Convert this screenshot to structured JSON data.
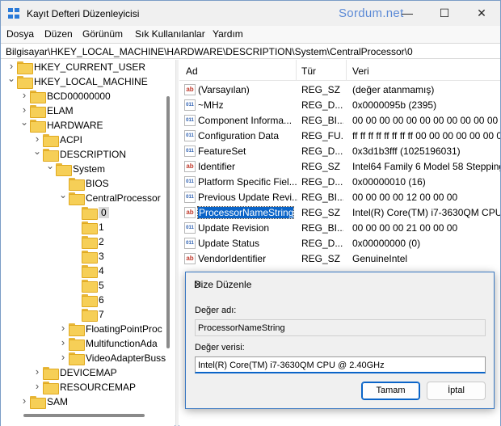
{
  "window": {
    "title": "Kayıt Defteri Düzenleyicisi",
    "watermark": "Sordum.net",
    "minimize": "—",
    "maximize": "☐",
    "close": "✕"
  },
  "menu": [
    "Dosya",
    "Düzen",
    "Görünüm",
    "Sık Kullanılanlar",
    "Yardım"
  ],
  "address": "Bilgisayar\\HKEY_LOCAL_MACHINE\\HARDWARE\\DESCRIPTION\\System\\CentralProcessor\\0",
  "tree": [
    {
      "label": "HKEY_CURRENT_USER",
      "level": 0,
      "chev": ">"
    },
    {
      "label": "HKEY_LOCAL_MACHINE",
      "level": 0,
      "chev": "v"
    },
    {
      "label": "BCD00000000",
      "level": 1,
      "chev": ">"
    },
    {
      "label": "ELAM",
      "level": 1,
      "chev": ">"
    },
    {
      "label": "HARDWARE",
      "level": 1,
      "chev": "v"
    },
    {
      "label": "ACPI",
      "level": 2,
      "chev": ">"
    },
    {
      "label": "DESCRIPTION",
      "level": 2,
      "chev": "v"
    },
    {
      "label": "System",
      "level": 3,
      "chev": "v"
    },
    {
      "label": "BIOS",
      "level": 4,
      "chev": ""
    },
    {
      "label": "CentralProcessor",
      "level": 4,
      "chev": "v"
    },
    {
      "label": "0",
      "level": 5,
      "chev": "",
      "selected": true
    },
    {
      "label": "1",
      "level": 5,
      "chev": ""
    },
    {
      "label": "2",
      "level": 5,
      "chev": ""
    },
    {
      "label": "3",
      "level": 5,
      "chev": ""
    },
    {
      "label": "4",
      "level": 5,
      "chev": ""
    },
    {
      "label": "5",
      "level": 5,
      "chev": ""
    },
    {
      "label": "6",
      "level": 5,
      "chev": ""
    },
    {
      "label": "7",
      "level": 5,
      "chev": ""
    },
    {
      "label": "FloatingPointProc",
      "level": 4,
      "chev": ">"
    },
    {
      "label": "MultifunctionAda",
      "level": 4,
      "chev": ">"
    },
    {
      "label": "VideoAdapterBuss",
      "level": 4,
      "chev": ">"
    },
    {
      "label": "DEVICEMAP",
      "level": 2,
      "chev": ">"
    },
    {
      "label": "RESOURCEMAP",
      "level": 2,
      "chev": ">"
    },
    {
      "label": "SAM",
      "level": 1,
      "chev": ">"
    }
  ],
  "list": {
    "headers": [
      "Ad",
      "Tür",
      "Veri"
    ],
    "rows": [
      {
        "name": "(Varsayılan)",
        "type": "REG_SZ",
        "data": "(değer atanmamış)",
        "icon": "ab"
      },
      {
        "name": "~MHz",
        "type": "REG_D...",
        "data": "0x0000095b (2395)",
        "icon": "bin"
      },
      {
        "name": "Component Informa...",
        "type": "REG_BI...",
        "data": "00 00 00 00 00 00 00 00 00 00 00 00",
        "icon": "bin"
      },
      {
        "name": "Configuration Data",
        "type": "REG_FU...",
        "data": "ff ff ff ff ff ff ff ff 00 00 00 00 00 00 00 0",
        "icon": "bin"
      },
      {
        "name": "FeatureSet",
        "type": "REG_D...",
        "data": "0x3d1b3fff (1025196031)",
        "icon": "bin"
      },
      {
        "name": "Identifier",
        "type": "REG_SZ",
        "data": "Intel64 Family 6 Model 58 Stepping",
        "icon": "ab"
      },
      {
        "name": "Platform Specific Fiel...",
        "type": "REG_D...",
        "data": "0x00000010 (16)",
        "icon": "bin"
      },
      {
        "name": "Previous Update Revi...",
        "type": "REG_BI...",
        "data": "00 00 00 00 12 00 00 00",
        "icon": "bin"
      },
      {
        "name": "ProcessorNameString",
        "type": "REG_SZ",
        "data": "Intel(R) Core(TM) i7-3630QM CPU",
        "icon": "ab",
        "selected": true
      },
      {
        "name": "Update Revision",
        "type": "REG_BI...",
        "data": "00 00 00 00 21 00 00 00",
        "icon": "bin"
      },
      {
        "name": "Update Status",
        "type": "REG_D...",
        "data": "0x00000000 (0)",
        "icon": "bin"
      },
      {
        "name": "VendorIdentifier",
        "type": "REG_SZ",
        "data": "GenuineIntel",
        "icon": "ab"
      }
    ]
  },
  "dialog": {
    "title": "Dize Düzenle",
    "close": "✕",
    "name_label": "Değer adı:",
    "name_value": "ProcessorNameString",
    "data_label": "Değer verisi:",
    "data_value": "Intel(R) Core(TM) i7-3630QM CPU @ 2.40GHz",
    "ok": "Tamam",
    "cancel": "İptal"
  }
}
